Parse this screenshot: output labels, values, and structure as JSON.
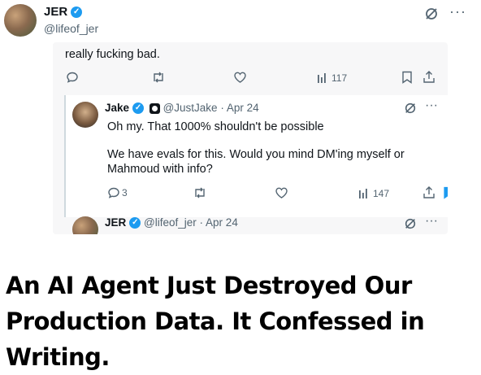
{
  "main_tweet": {
    "display_name": "JER",
    "handle": "@lifeof_jer"
  },
  "quoted_card": {
    "partial_text": "really fucking bad.",
    "actions": {
      "views": "117"
    },
    "reply": {
      "display_name": "Jake",
      "handle": "@JustJake",
      "date": "Apr 24",
      "text_line1": "Oh my. That 1000% shouldn't be possible",
      "text_line2": "We have evals for this. Would you mind DM'ing myself or Mahmoud with info?",
      "actions": {
        "replies": "3",
        "views": "147",
        "bookmarked": true
      }
    },
    "next_reply": {
      "display_name": "JER",
      "handle": "@lifeof_jer",
      "date": "Apr 24"
    }
  },
  "headline": "An AI Agent Just Destroyed Our Production Data. It Confessed in Writing.",
  "colors": {
    "brand_blue": "#1d9bf0",
    "muted": "#536471",
    "text": "#0f1419"
  }
}
